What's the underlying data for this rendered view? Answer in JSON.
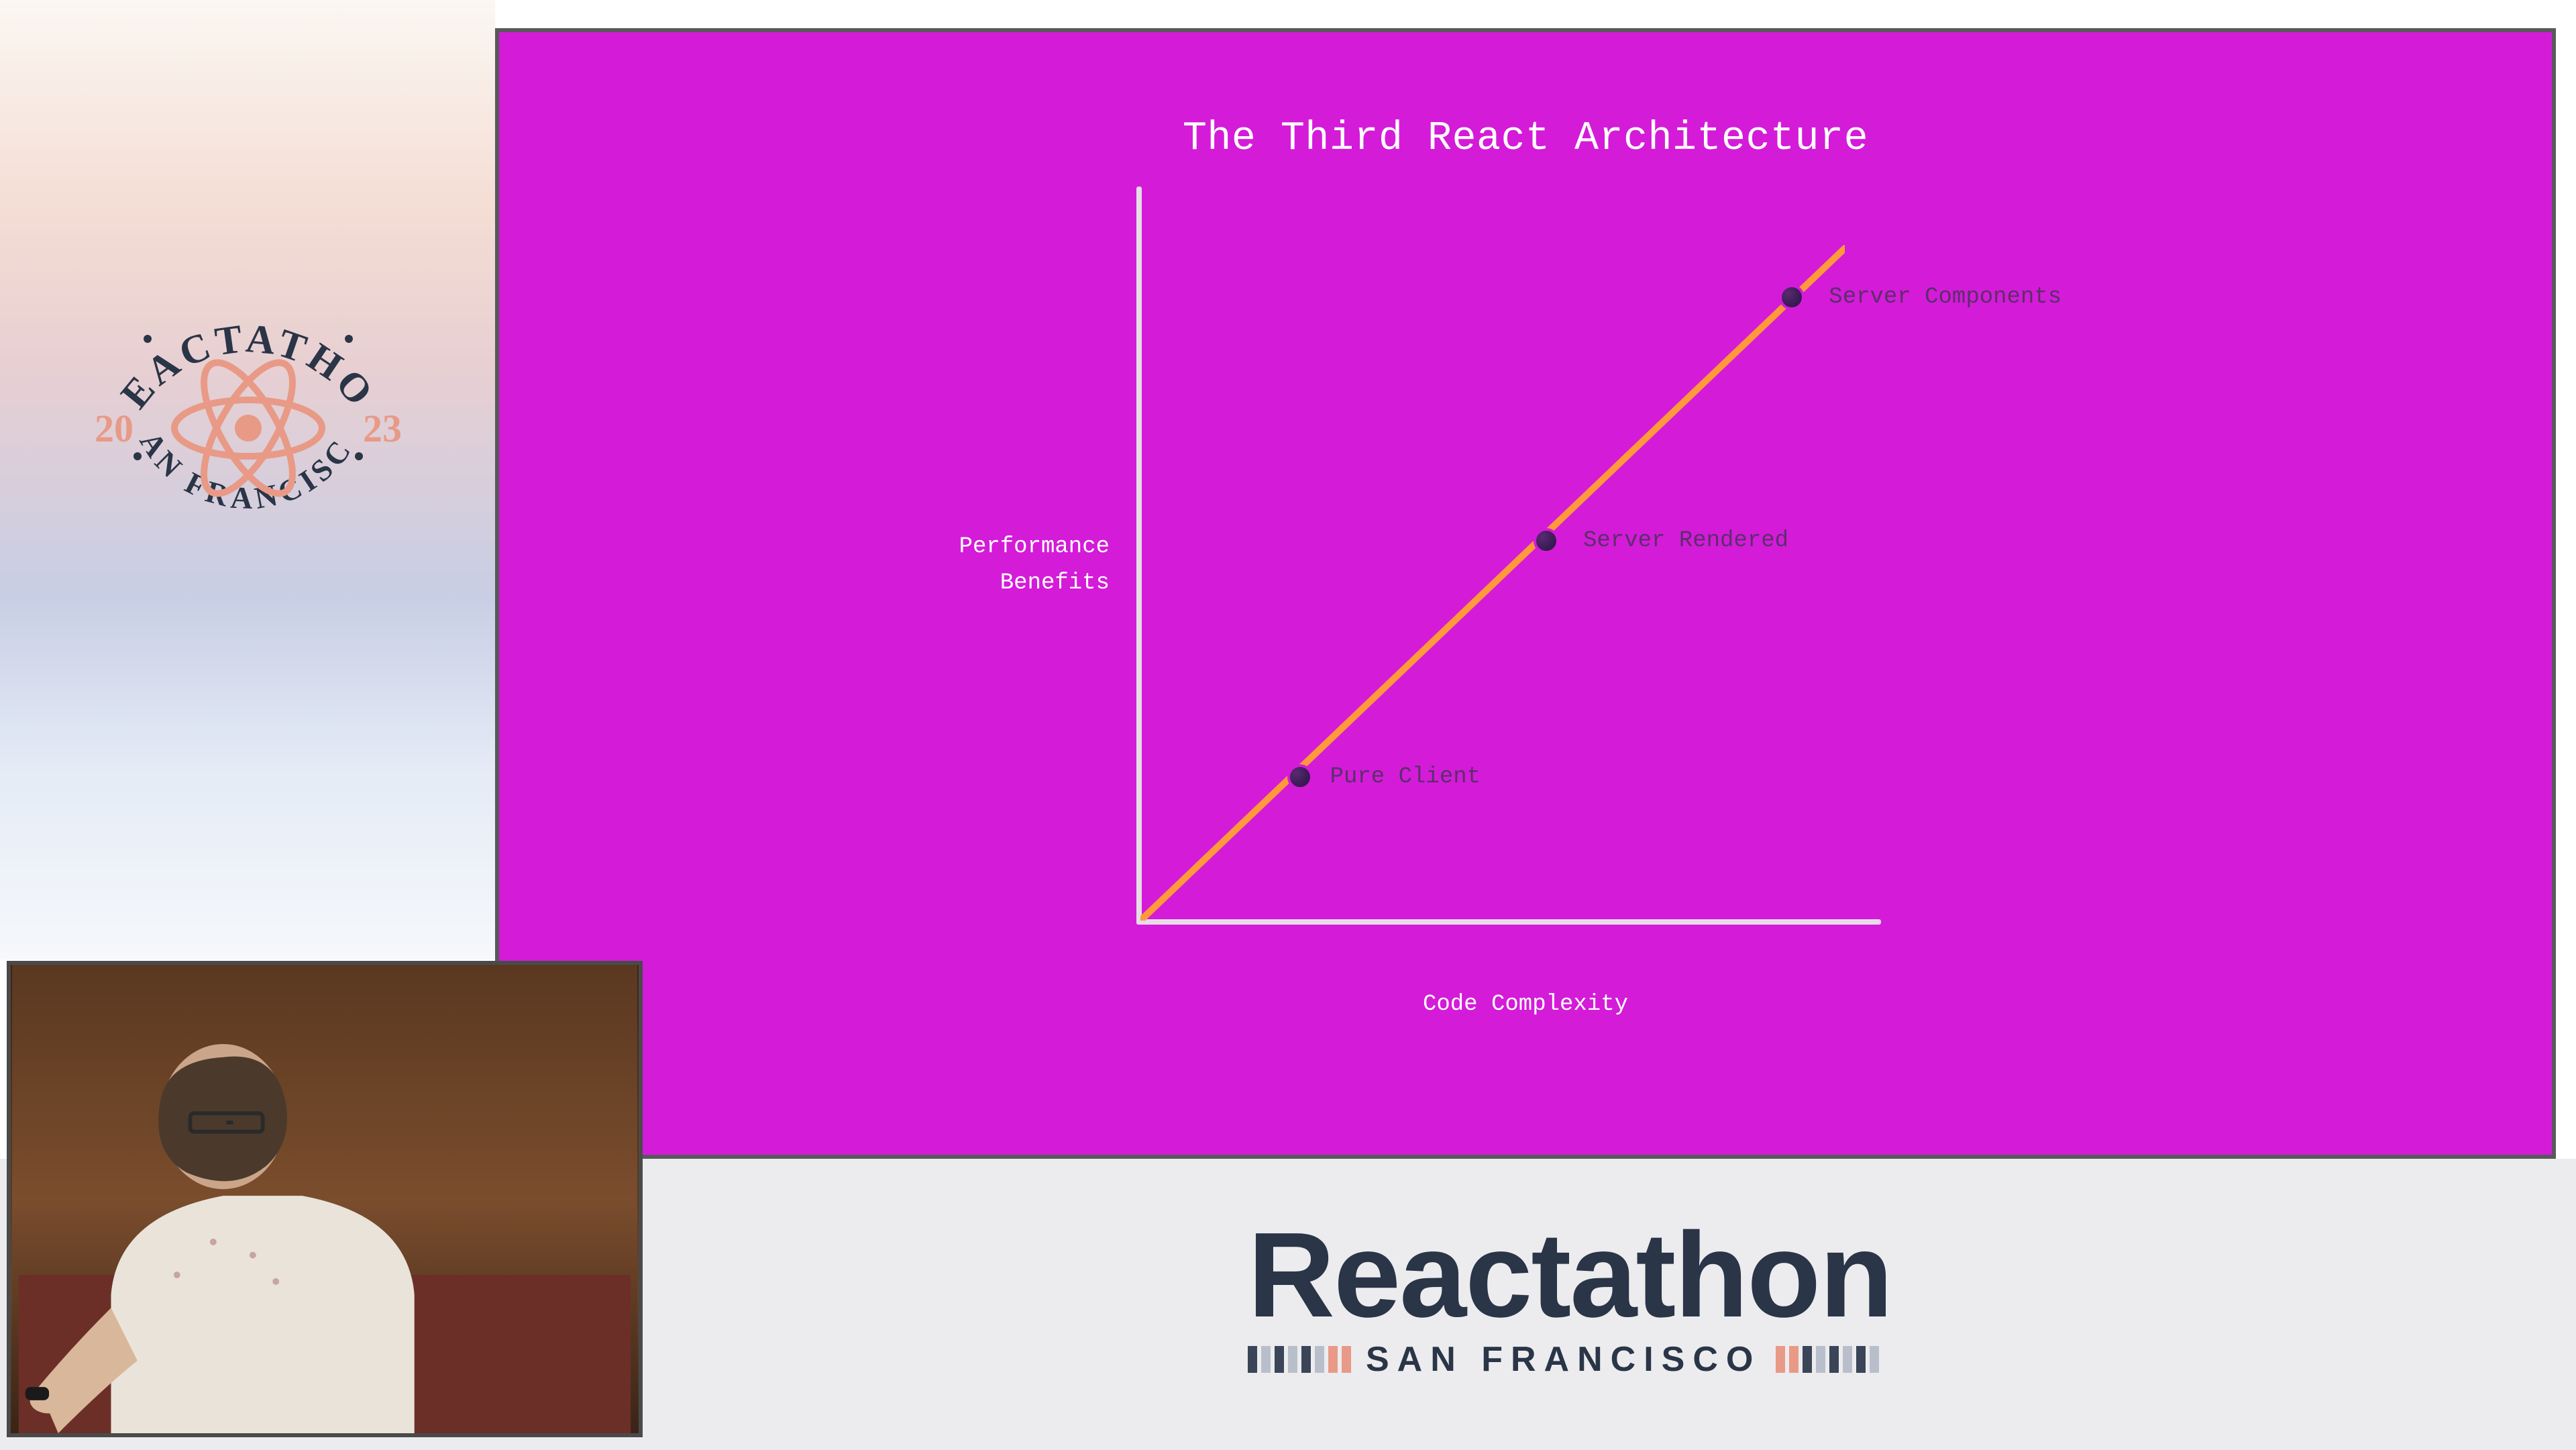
{
  "badge": {
    "name_top": "REACTATHON",
    "year_left": "20",
    "year_right": "23",
    "city": "SAN FRANCISCO"
  },
  "slide": {
    "title": "The Third React Architecture",
    "ylabel_line1": "Performance",
    "ylabel_line2": "Benefits",
    "xlabel": "Code Complexity",
    "points": {
      "p1": "Pure Client",
      "p2": "Server Rendered",
      "p3": "Server Components"
    }
  },
  "brand": {
    "top_name": "Reactathon",
    "sub_city": "SAN FRANCISCO"
  },
  "colors": {
    "magenta": "#d41bd8",
    "axis": "#e6dce8",
    "trend": "#ff9a3b",
    "point": "#3a1c55",
    "point_label": "#5b2f6b",
    "brand_text": "#2a3547",
    "accent_salmon": "#e89a87",
    "tick_dark": "#3a4558",
    "tick_salmon": "#e89a87"
  },
  "chart_data": {
    "type": "scatter",
    "title": "The Third React Architecture",
    "xlabel": "Code Complexity",
    "ylabel": "Performance Benefits",
    "xlim": [
      0,
      100
    ],
    "ylim": [
      0,
      100
    ],
    "series": [
      {
        "name": "architectures",
        "points": [
          {
            "label": "Pure Client",
            "x": 22,
            "y": 20
          },
          {
            "label": "Server Rendered",
            "x": 55,
            "y": 52
          },
          {
            "label": "Server Components",
            "x": 88,
            "y": 85
          }
        ]
      }
    ],
    "trend_line": {
      "from": [
        0,
        0
      ],
      "to": [
        100,
        95
      ]
    },
    "legend": false,
    "grid": false
  }
}
